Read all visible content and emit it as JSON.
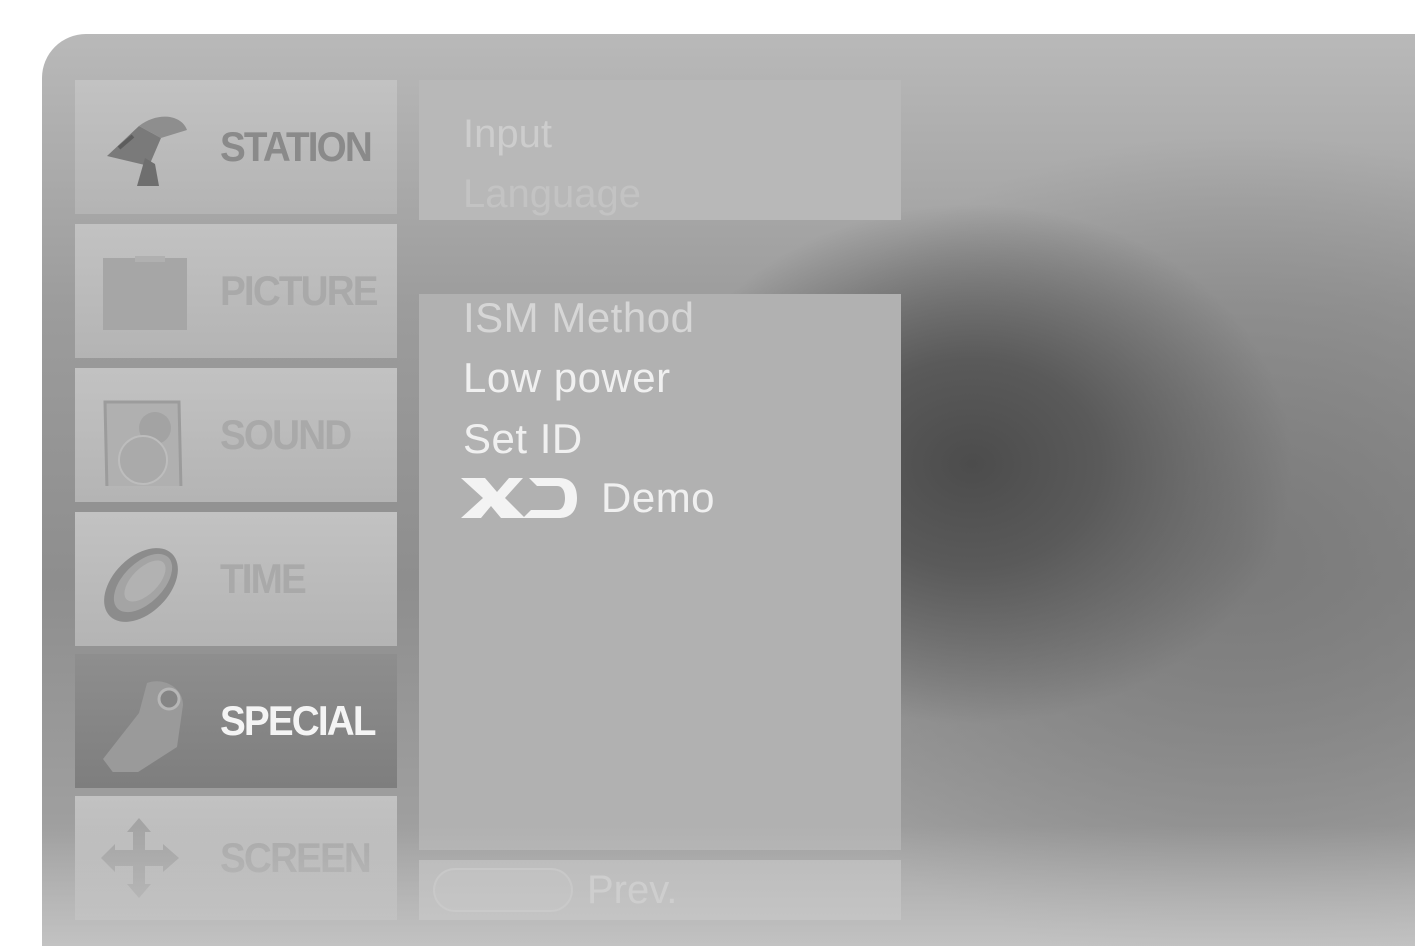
{
  "sidebar": {
    "items": [
      {
        "label": "STATION",
        "icon": "satellite-dish-icon"
      },
      {
        "label": "PICTURE",
        "icon": "picture-frame-icon"
      },
      {
        "label": "SOUND",
        "icon": "speaker-icon"
      },
      {
        "label": "TIME",
        "icon": "clock-icon"
      },
      {
        "label": "SPECIAL",
        "icon": "tag-icon",
        "selected": true
      },
      {
        "label": "SCREEN",
        "icon": "move-arrows-icon"
      }
    ]
  },
  "submenu_top": {
    "items": [
      "Input",
      "Language"
    ]
  },
  "submenu": {
    "items": [
      {
        "label": "ISM Method"
      },
      {
        "label": "Low power"
      },
      {
        "label": "Set ID"
      },
      {
        "label": "Demo",
        "logo": "XD"
      }
    ]
  },
  "footer": {
    "prev_label": "Prev."
  },
  "colors": {
    "osd_background": "#9c9c9c",
    "selected_item": "#858585",
    "item_background": "#bcbcbc",
    "text_active": "#f0f0f0"
  }
}
